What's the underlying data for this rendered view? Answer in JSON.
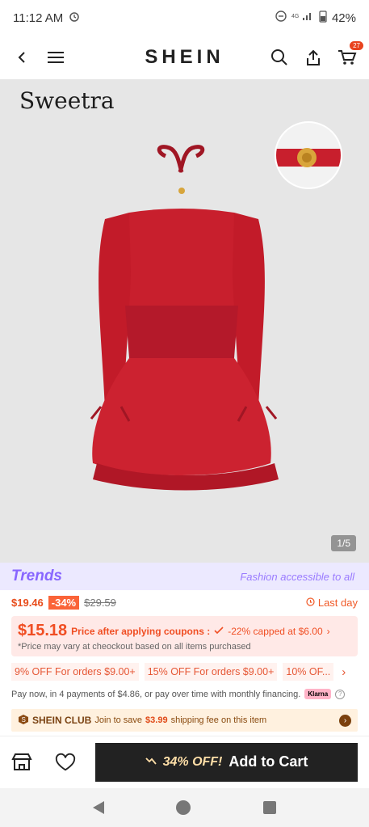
{
  "status_bar": {
    "time": "11:12 AM",
    "battery": "42%"
  },
  "header": {
    "brand": "SHEIN",
    "cart_count": "27"
  },
  "hero": {
    "brand_text": "Sweetra",
    "pager": "1/5"
  },
  "trends": {
    "logo": "Trends",
    "slogan": "Fashion accessible to all"
  },
  "price": {
    "current": "$19.46",
    "discount": "-34%",
    "original": "$29.59",
    "timer_label": "Last day"
  },
  "coupon": {
    "price": "$15.18",
    "label": "Price after applying coupons :",
    "extra": "-22% capped at $6.00",
    "note": "*Price may vary at cheockout based on all items purchased"
  },
  "offers": [
    {
      "label": "9% OFF For orders $9.00+"
    },
    {
      "label": "15% OFF For orders $9.00+"
    },
    {
      "label": "10% OF..."
    }
  ],
  "installment": {
    "text": "Pay now, in 4 payments of $4.86, or pay over time with monthly financing.",
    "provider": "Klarna"
  },
  "club": {
    "title": "SHEIN CLUB",
    "text_before": "Join to save",
    "amount": "$3.99",
    "text_after": "shipping fee on this item"
  },
  "cta": {
    "discount": "34% OFF!",
    "label": "Add to Cart"
  },
  "colors": {
    "accent": "#fa6338",
    "price": "#e84d1c",
    "trends": "#8866ff",
    "dress": "#d31f2f"
  }
}
